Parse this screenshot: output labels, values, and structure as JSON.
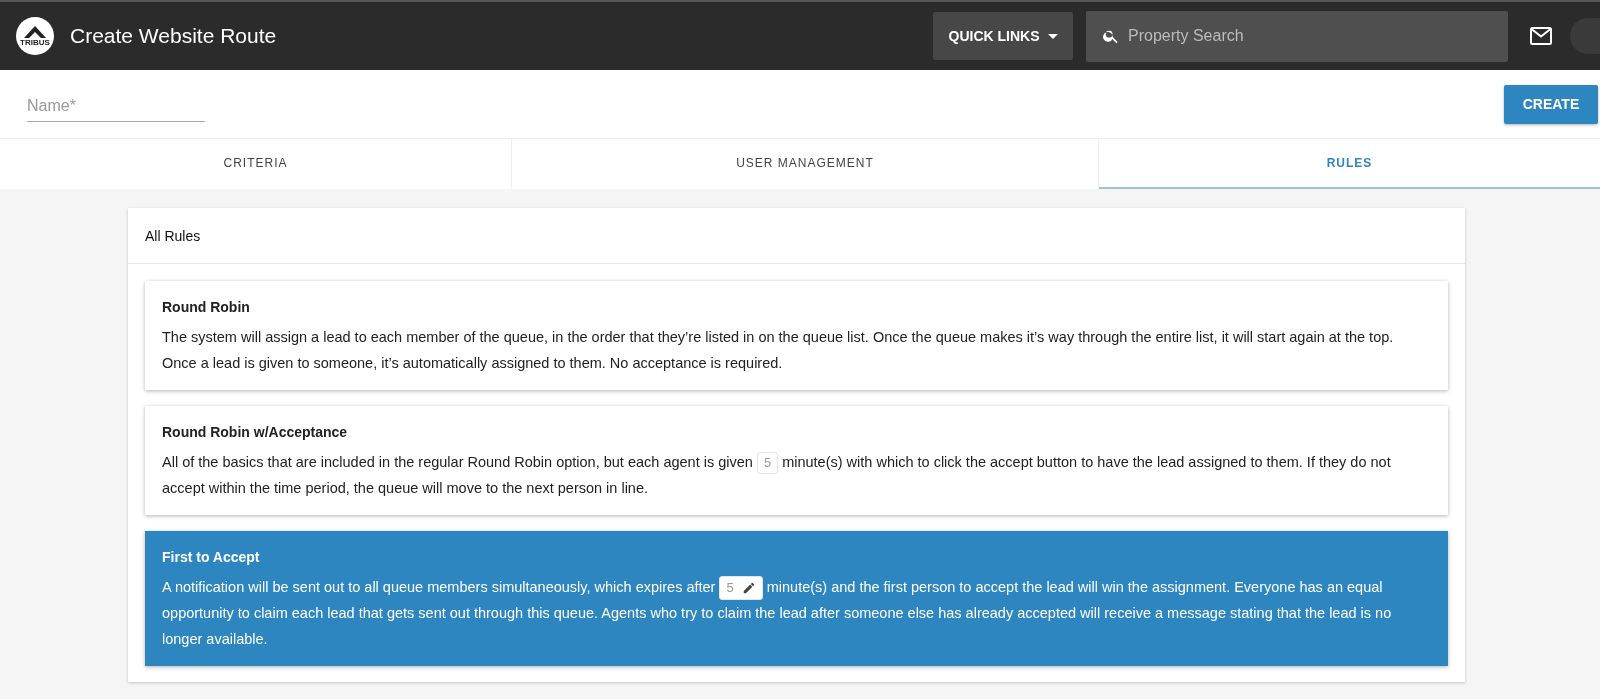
{
  "header": {
    "title": "Create Website Route",
    "logo_text": "TRIBUS",
    "quick_links": "QUICK LINKS",
    "search": {
      "placeholder": "Property Search"
    }
  },
  "form": {
    "name": {
      "placeholder": "Name*"
    },
    "create_button": "CREATE"
  },
  "tabs": [
    {
      "label": "CRITERIA",
      "selected": false
    },
    {
      "label": "USER MANAGEMENT",
      "selected": false
    },
    {
      "label": "RULES",
      "selected": true
    }
  ],
  "panel": {
    "title": "All Rules",
    "rules": [
      {
        "kind": "plain",
        "title": "Round Robin",
        "selected": false,
        "text": "The system will assign a lead to each member of the queue, in the order that they’re listed in on the queue list. Once the queue makes it’s way through the entire list, it will start again at the top. Once a lead is given to someone, it’s automatically assigned to them. No acceptance is required."
      },
      {
        "kind": "timed",
        "title": "Round Robin w/Acceptance",
        "selected": false,
        "text_before": "All of the basics that are included in the regular Round Robin option, but each agent is given",
        "minutes": "5",
        "text_after": "minute(s) with which to click the accept button to have the lead assigned to them. If they do not accept within the time period, the queue will move to the next person in line."
      },
      {
        "kind": "timed",
        "title": "First to Accept",
        "selected": true,
        "text_before": "A notification will be sent out to all queue members simultaneously, which expires after",
        "minutes": "5",
        "text_after": "minute(s) and the first person to accept the lead will win the assignment. Everyone has an equal opportunity to claim each lead that gets sent out through this queue. Agents who try to claim the lead after someone else has already accepted will receive a message stating that the lead is no longer available."
      }
    ]
  }
}
